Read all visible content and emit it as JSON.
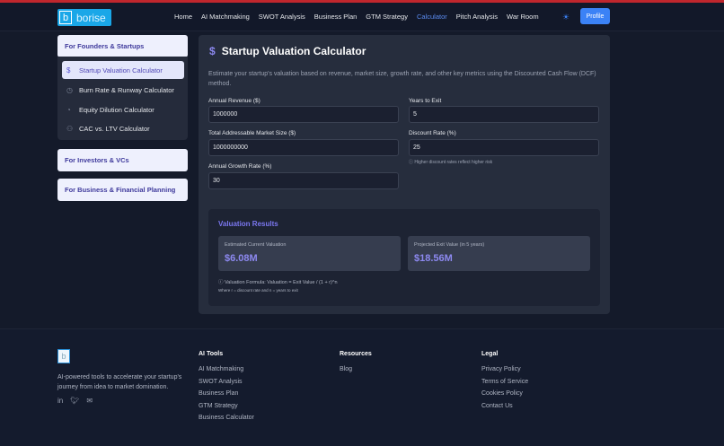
{
  "nav": {
    "logo": "borise",
    "logo_letter": "b",
    "links": [
      "Home",
      "AI Matchmaking",
      "SWOT Analysis",
      "Business Plan",
      "GTM Strategy",
      "Calculator",
      "Pitch Analysis",
      "War Room"
    ],
    "active": "Calculator",
    "profile": "Profile"
  },
  "sidebar": {
    "sections": [
      "For Founders & Startups",
      "For Investors & VCs",
      "For Business & Financial Planning"
    ],
    "items": [
      {
        "label": "Startup Valuation Calculator",
        "icon": "$"
      },
      {
        "label": "Burn Rate & Runway Calculator",
        "icon": "◷"
      },
      {
        "label": "Equity Dilution Calculator",
        "icon": "◔"
      },
      {
        "label": "CAC vs. LTV Calculator",
        "icon": "⚇"
      }
    ]
  },
  "main": {
    "title": "Startup Valuation Calculator",
    "icon": "$",
    "description": "Estimate your startup's valuation based on revenue, market size, growth rate, and other key metrics using the Discounted Cash Flow (DCF) method.",
    "fields": {
      "revenue": {
        "label": "Annual Revenue ($)",
        "value": "1000000"
      },
      "tam": {
        "label": "Total Addressable Market Size ($)",
        "value": "1000000000"
      },
      "growth": {
        "label": "Annual Growth Rate (%)",
        "value": "30"
      },
      "years": {
        "label": "Years to Exit",
        "value": "5"
      },
      "discount": {
        "label": "Discount Rate (%)",
        "value": "25"
      }
    },
    "hint": "ⓘ Higher discount rates reflect higher risk",
    "results": {
      "title": "Valuation Results",
      "current_label": "Estimated Current Valuation",
      "current_value": "$6.08M",
      "exit_label": "Projected Exit Value (in 5 years)",
      "exit_value": "$18.56M",
      "formula": "ⓘ Valuation Formula: Valuation = Exit Value / (1 + r)^n",
      "where": "Where r = discount rate and n = years to exit"
    }
  },
  "footer": {
    "logo_letter": "b",
    "tagline": "AI-powered tools to accelerate your startup's journey from idea to market domination.",
    "cols": [
      {
        "title": "AI Tools",
        "links": [
          "AI Matchmaking",
          "SWOT Analysis",
          "Business Plan",
          "GTM Strategy",
          "Business Calculator"
        ]
      },
      {
        "title": "Resources",
        "links": [
          "Blog"
        ]
      },
      {
        "title": "Legal",
        "links": [
          "Privacy Policy",
          "Terms of Service",
          "Cookies Policy",
          "Contact Us"
        ]
      }
    ]
  },
  "colors": {
    "accent": "#3b82f6",
    "brand": "#1aa7e8",
    "purple": "#8d89f0",
    "topline": "#c0262d"
  }
}
